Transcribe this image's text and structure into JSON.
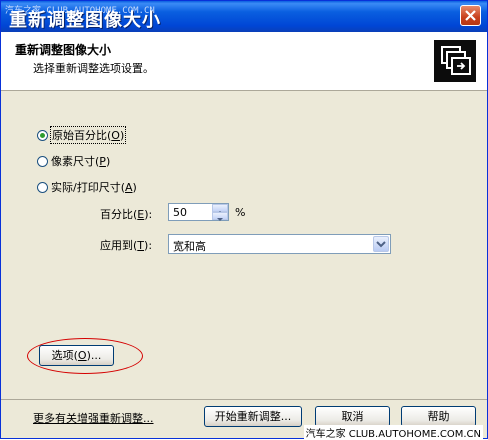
{
  "window": {
    "title": "重新调整图像大小",
    "watermark_top": "汽车之家 CLUB.AUTOHOME.COM.CN",
    "watermark_bottom": "汽车之家 CLUB.AUTOHOME.COM.CN"
  },
  "header": {
    "title": "重新调整图像大小",
    "subtitle": "选择重新调整选项设置。"
  },
  "options": {
    "radio_original_percent": {
      "label": "原始百分比(",
      "key": "O",
      "end": ")",
      "checked": true
    },
    "radio_pixel_size": {
      "label": "像素尺寸(",
      "key": "P",
      "end": ")",
      "checked": false
    },
    "radio_actual_print": {
      "label": "实际/打印尺寸(",
      "key": "A",
      "end": ")",
      "checked": false
    }
  },
  "percent": {
    "label": "百分比(",
    "key": "E",
    "end": "):",
    "value": "50",
    "unit": "%"
  },
  "apply_to": {
    "label": "应用到(",
    "key": "T",
    "end": "):",
    "value": "宽和高"
  },
  "buttons": {
    "options": {
      "label": "选项(",
      "key": "O",
      "end": ")..."
    },
    "start": "开始重新调整...",
    "cancel": "取消",
    "help": "帮助"
  },
  "footer_link": "更多有关增强重新调整...",
  "colors": {
    "titlebar": "#0a5fe0",
    "accent_red": "#d40000",
    "radio_dot": "#2f9c2f"
  }
}
